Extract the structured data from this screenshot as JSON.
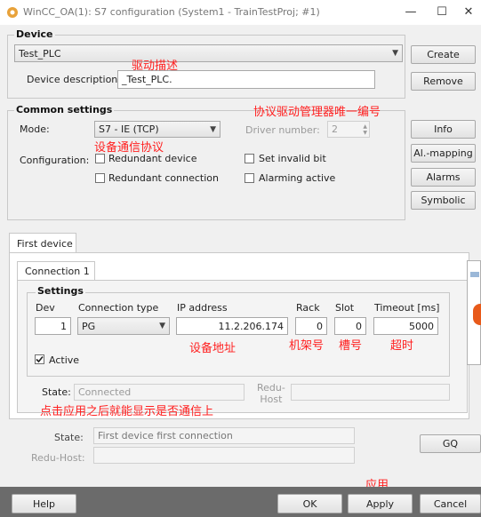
{
  "window": {
    "title": "WinCC_OA(1): S7 configuration (System1 - TrainTestProj; #1)",
    "minimize_glyph": "—",
    "maximize_glyph": "☐",
    "close_glyph": "✕"
  },
  "device": {
    "group_label": "Device",
    "selected_device": "Test_PLC",
    "description_label": "Device description:",
    "description_value": "_Test_PLC.",
    "create_label": "Create",
    "remove_label": "Remove"
  },
  "common": {
    "group_label": "Common settings",
    "mode_label": "Mode:",
    "mode_value": "S7 - IE (TCP)",
    "driver_number_label": "Driver number:",
    "driver_number_value": "2",
    "configuration_label": "Configuration:",
    "redundant_device": "Redundant device",
    "redundant_connection": "Redundant connection",
    "set_invalid_bit": "Set invalid bit",
    "alarming_active": "Alarming active",
    "info_label": "Info",
    "al_mapping_label": "Al.-mapping",
    "alarms_label": "Alarms",
    "symbolic_label": "Symbolic"
  },
  "tabs": {
    "first_device": "First device",
    "connection_1": "Connection 1"
  },
  "settings": {
    "group_label": "Settings",
    "dev_label": "Dev",
    "dev_value": "1",
    "connection_type_label": "Connection type",
    "connection_type_value": "PG",
    "ip_label": "IP address",
    "ip_value": "11.2.206.174",
    "rack_label": "Rack",
    "rack_value": "0",
    "slot_label": "Slot",
    "slot_value": "0",
    "timeout_label": "Timeout [ms]",
    "timeout_value": "5000",
    "active_label": "Active",
    "active_checked": true,
    "state_label": "State:",
    "state_value": "Connected",
    "redu_host_label_1": "Redu-",
    "redu_host_label_2": "Host"
  },
  "device_state": {
    "state_label": "State:",
    "state_value": "First device first connection",
    "redu_host_label": "Redu-Host:",
    "gq_label": "GQ"
  },
  "footer": {
    "help_label": "Help",
    "ok_label": "OK",
    "apply_label": "Apply",
    "cancel_label": "Cancel"
  },
  "annotations": {
    "driver_description": "驱动描述",
    "driver_number_note": "协议驱动管理器唯一编号",
    "protocol_note": "设备通信协议",
    "ip_note": "设备地址",
    "rack_note": "机架号",
    "slot_note": "槽号",
    "timeout_note": "超时",
    "apply_note": "点击应用之后就能显示是否通信上",
    "apply_label_note": "应用"
  },
  "colors": {
    "annotation": "#ff2020",
    "footer_bar": "#6b6b6b"
  }
}
